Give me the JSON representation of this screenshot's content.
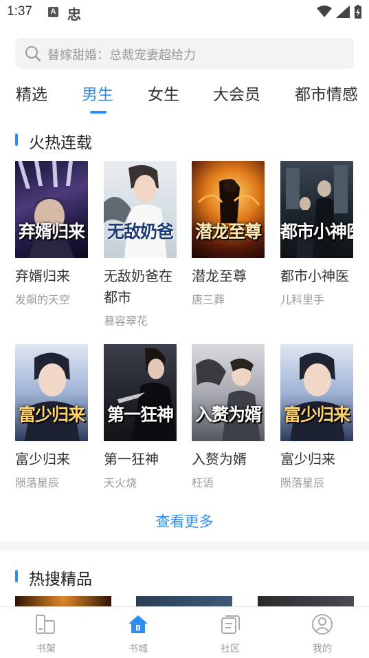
{
  "status_bar": {
    "time": "1:37",
    "badge_a": "A",
    "bug_glyph": "忠"
  },
  "search": {
    "placeholder": "替嫁甜婚：总裁宠妻超给力"
  },
  "tabs": [
    {
      "label": "精选"
    },
    {
      "label": "男生"
    },
    {
      "label": "女生"
    },
    {
      "label": "大会员"
    },
    {
      "label": "都市情感"
    }
  ],
  "active_tab": "男生",
  "hot_serial": {
    "title": "火热连载",
    "books": [
      {
        "title": "弃婿归来",
        "author": "发飙的天空",
        "cover_text": "弃婿归来"
      },
      {
        "title": "无敌奶爸在都市",
        "author": "慕容翠花",
        "cover_text": "无敌奶爸"
      },
      {
        "title": "潜龙至尊",
        "author": "唐三葬",
        "cover_text": "潜龙至尊"
      },
      {
        "title": "都市小神医",
        "author": "儿科里手",
        "cover_text": "都市小神医"
      },
      {
        "title": "富少归来",
        "author": "陨落星辰",
        "cover_text": "富少归来"
      },
      {
        "title": "第一狂神",
        "author": "天火烧",
        "cover_text": "第一狂神"
      },
      {
        "title": "入赘为婿",
        "author": "枉语",
        "cover_text": "入赘为婿"
      },
      {
        "title": "富少归来",
        "author": "陨落星辰",
        "cover_text": "富少归来"
      }
    ],
    "more_label": "查看更多"
  },
  "hot_search": {
    "title": "热搜精品"
  },
  "bottom_nav": [
    {
      "label": "书架",
      "icon": "bookshelf-icon"
    },
    {
      "label": "书城",
      "icon": "bookstore-icon"
    },
    {
      "label": "社区",
      "icon": "community-icon"
    },
    {
      "label": "我的",
      "icon": "profile-icon"
    }
  ],
  "colors": {
    "accent": "#2b8ff0",
    "text": "#333333",
    "muted": "#9a9a9a",
    "band": "#f5f5f5"
  }
}
